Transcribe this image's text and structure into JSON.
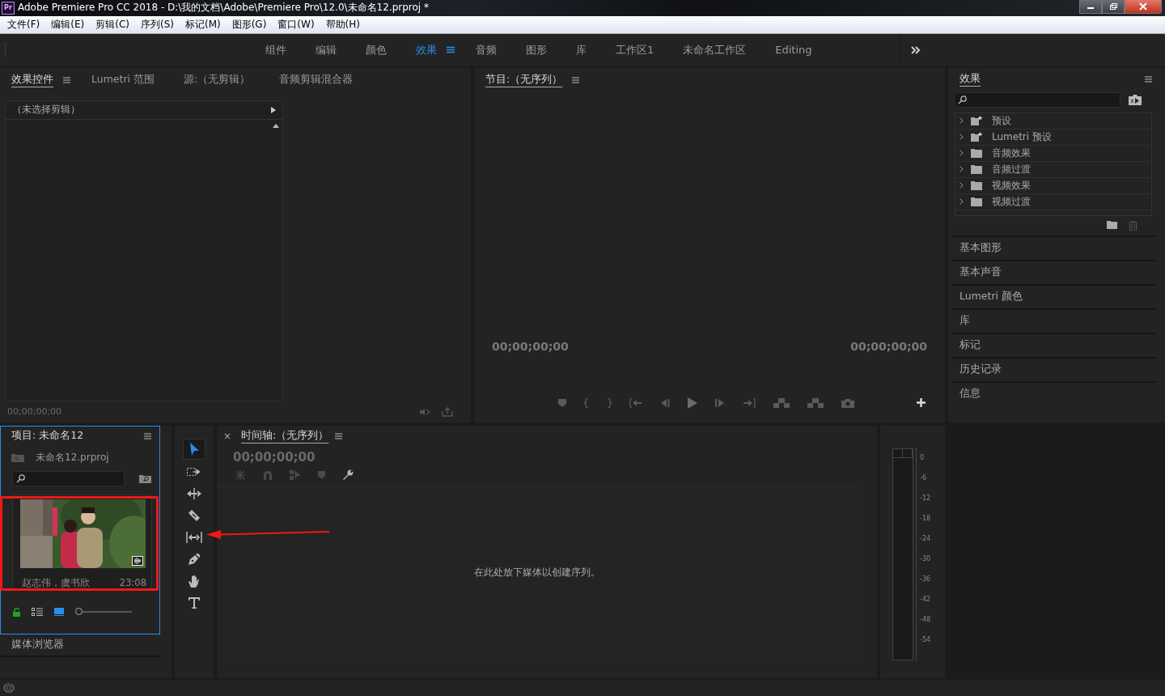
{
  "window": {
    "app_icon": "Pr",
    "title": "Adobe Premiere Pro CC 2018 - D:\\我的文档\\Adobe\\Premiere Pro\\12.0\\未命名12.prproj *"
  },
  "menu": [
    "文件(F)",
    "编辑(E)",
    "剪辑(C)",
    "序列(S)",
    "标记(M)",
    "图形(G)",
    "窗口(W)",
    "帮助(H)"
  ],
  "workspaces": [
    {
      "label": "组件",
      "selected": false
    },
    {
      "label": "编辑",
      "selected": false
    },
    {
      "label": "颜色",
      "selected": false
    },
    {
      "label": "效果",
      "selected": true
    },
    {
      "label": "音频",
      "selected": false
    },
    {
      "label": "图形",
      "selected": false
    },
    {
      "label": "库",
      "selected": false
    },
    {
      "label": "工作区1",
      "selected": false
    },
    {
      "label": "未命名工作区",
      "selected": false
    },
    {
      "label": "Editing",
      "selected": false
    }
  ],
  "source_panel": {
    "tabs": [
      {
        "label": "效果控件",
        "selected": true
      },
      {
        "label": "Lumetri 范围",
        "selected": false
      },
      {
        "label": "源:（无剪辑）",
        "selected": false
      },
      {
        "label": "音频剪辑混合器",
        "selected": false
      }
    ],
    "clip_header": "（未选择剪辑）",
    "timecode": "00;00;00;00"
  },
  "program": {
    "title": "节目:（无序列）",
    "timecode_left": "00;00;00;00",
    "timecode_right": "00;00;00;00"
  },
  "effects": {
    "title": "效果",
    "items": [
      {
        "label": "预设",
        "kind": "preset"
      },
      {
        "label": "Lumetri 预设",
        "kind": "preset"
      },
      {
        "label": "音频效果",
        "kind": "folder"
      },
      {
        "label": "音频过渡",
        "kind": "folder"
      },
      {
        "label": "视频效果",
        "kind": "folder"
      },
      {
        "label": "视频过渡",
        "kind": "folder"
      }
    ],
    "panels": [
      "基本图形",
      "基本声音",
      "Lumetri 颜色",
      "库",
      "标记",
      "历史记录",
      "信息"
    ]
  },
  "project": {
    "title": "项目: 未命名12",
    "file": "未命名12.prproj",
    "clip": {
      "name": "赵志伟，虞书欣",
      "duration": "23:08",
      "kind": "picture"
    },
    "zoom": {
      "level": 0
    }
  },
  "media_browser": "媒体浏览器",
  "tools": [
    {
      "kind": "selection",
      "selected": true
    },
    {
      "kind": "track-select",
      "selected": false
    },
    {
      "kind": "ripple",
      "selected": false
    },
    {
      "kind": "razor",
      "selected": false
    },
    {
      "kind": "slip",
      "selected": false
    },
    {
      "kind": "pen",
      "selected": false
    },
    {
      "kind": "hand",
      "selected": false
    },
    {
      "kind": "type",
      "selected": false
    }
  ],
  "timeline": {
    "close": "×",
    "title": "时间轴:（无序列）",
    "timecode": "00;00;00;00",
    "empty_message": "在此处放下媒体以创建序列。"
  },
  "meter": {
    "scale": [
      "0",
      "-6",
      "-12",
      "-18",
      "-24",
      "-30",
      "-36",
      "-42",
      "-48",
      "-54"
    ]
  }
}
